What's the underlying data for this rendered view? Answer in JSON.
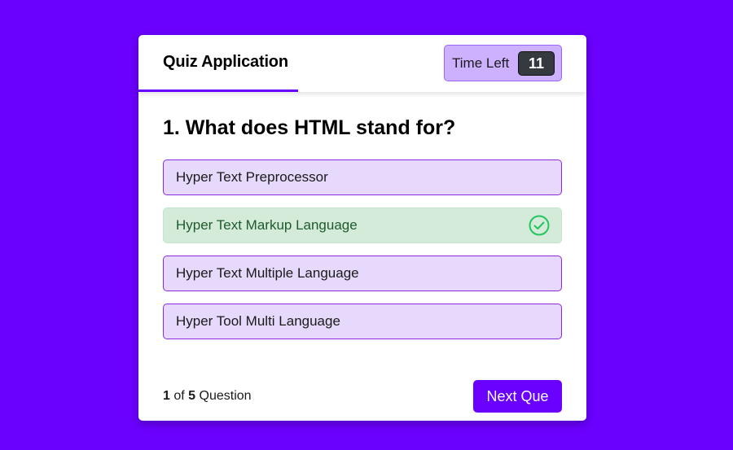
{
  "header": {
    "title": "Quiz Application",
    "timer_label": "Time Left",
    "timer_value": "11"
  },
  "question": {
    "text": "1. What does HTML stand for?",
    "options": [
      {
        "label": "Hyper Text Preprocessor",
        "state": "default"
      },
      {
        "label": "Hyper Text Markup Language",
        "state": "correct",
        "icon": "check-circle-icon"
      },
      {
        "label": "Hyper Text Multiple Language",
        "state": "default"
      },
      {
        "label": "Hyper Tool Multi Language",
        "state": "default"
      }
    ]
  },
  "footer": {
    "current": "1",
    "of_word": "of",
    "total": "5",
    "suffix": "Question",
    "next_label": "Next Que"
  },
  "colors": {
    "accent": "#6a00fd",
    "option_bg": "#e7d9fb",
    "correct_bg": "#d4ebda",
    "correct_check": "#22c55e"
  }
}
